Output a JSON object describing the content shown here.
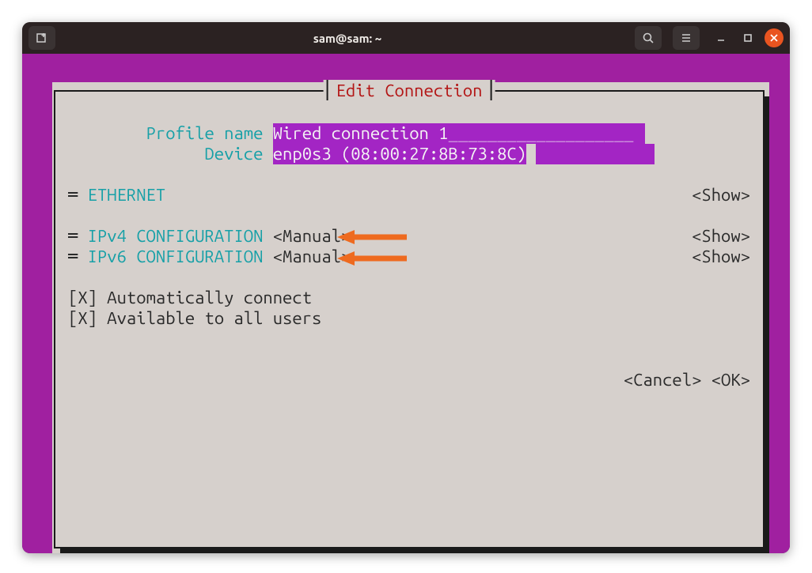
{
  "window": {
    "title": "sam@sam: ~"
  },
  "panel": {
    "title": "Edit Connection"
  },
  "profile": {
    "name_label": "Profile name",
    "name_value": "Wired connection 1",
    "device_label": "Device",
    "device_value": "enp0s3 (08:00:27:8B:73:8C)"
  },
  "sections": {
    "ethernet": {
      "label": "ETHERNET",
      "action": "<Show>"
    },
    "ipv4": {
      "label": "IPv4 CONFIGURATION",
      "mode": "<Manual>",
      "action": "<Show>"
    },
    "ipv6": {
      "label": "IPv6 CONFIGURATION",
      "mode": "<Manual>",
      "action": "<Show>"
    }
  },
  "checkboxes": {
    "auto_connect": {
      "mark": "[X]",
      "label": "Automatically connect"
    },
    "all_users": {
      "mark": "[X]",
      "label": "Available to all users"
    }
  },
  "buttons": {
    "cancel": "<Cancel>",
    "ok": "<OK>"
  },
  "colors": {
    "purple_bg": "#a020a0",
    "panel_bg": "#d6d0cc",
    "field_bg": "#a325c4",
    "label_cyan": "#17a0a7",
    "title_red": "#b31414",
    "arrow_orange": "#ee6a1f"
  }
}
